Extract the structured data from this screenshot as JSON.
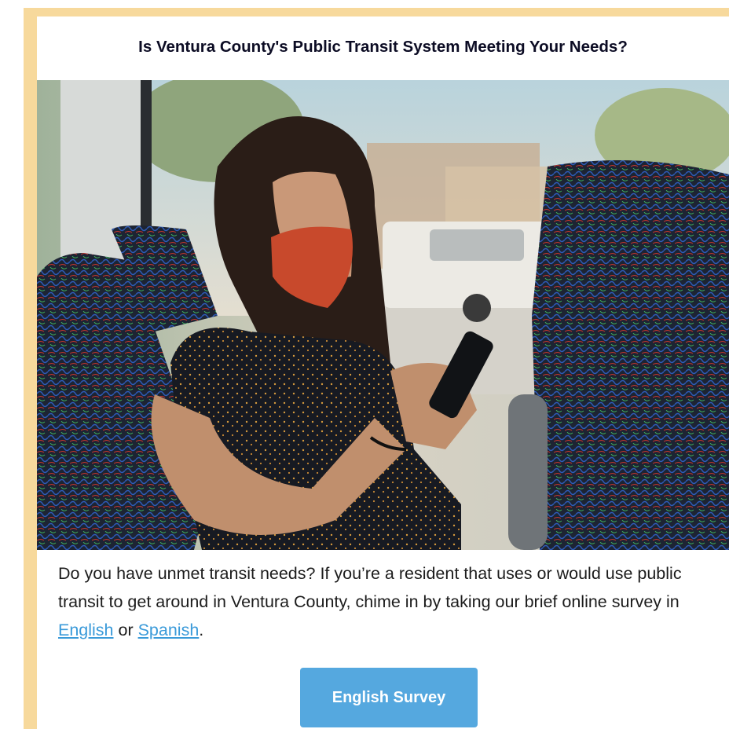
{
  "headline": "Is Ventura County's Public Transit System Meeting Your Needs?",
  "photo": {
    "subject": "bus-passenger-photo"
  },
  "body": {
    "text_before": "Do you have unmet transit needs? If you’re a resident that uses or would use public transit to get around in Ventura County, chime in by taking our brief online survey in ",
    "link_english": "English",
    "text_or": " or ",
    "link_spanish": "Spanish",
    "text_after": "."
  },
  "cta": {
    "label": "English Survey"
  },
  "colors": {
    "border": "#f7d99c",
    "link": "#3a9ad9",
    "button": "#55a8df",
    "headline": "#0c0c24"
  }
}
